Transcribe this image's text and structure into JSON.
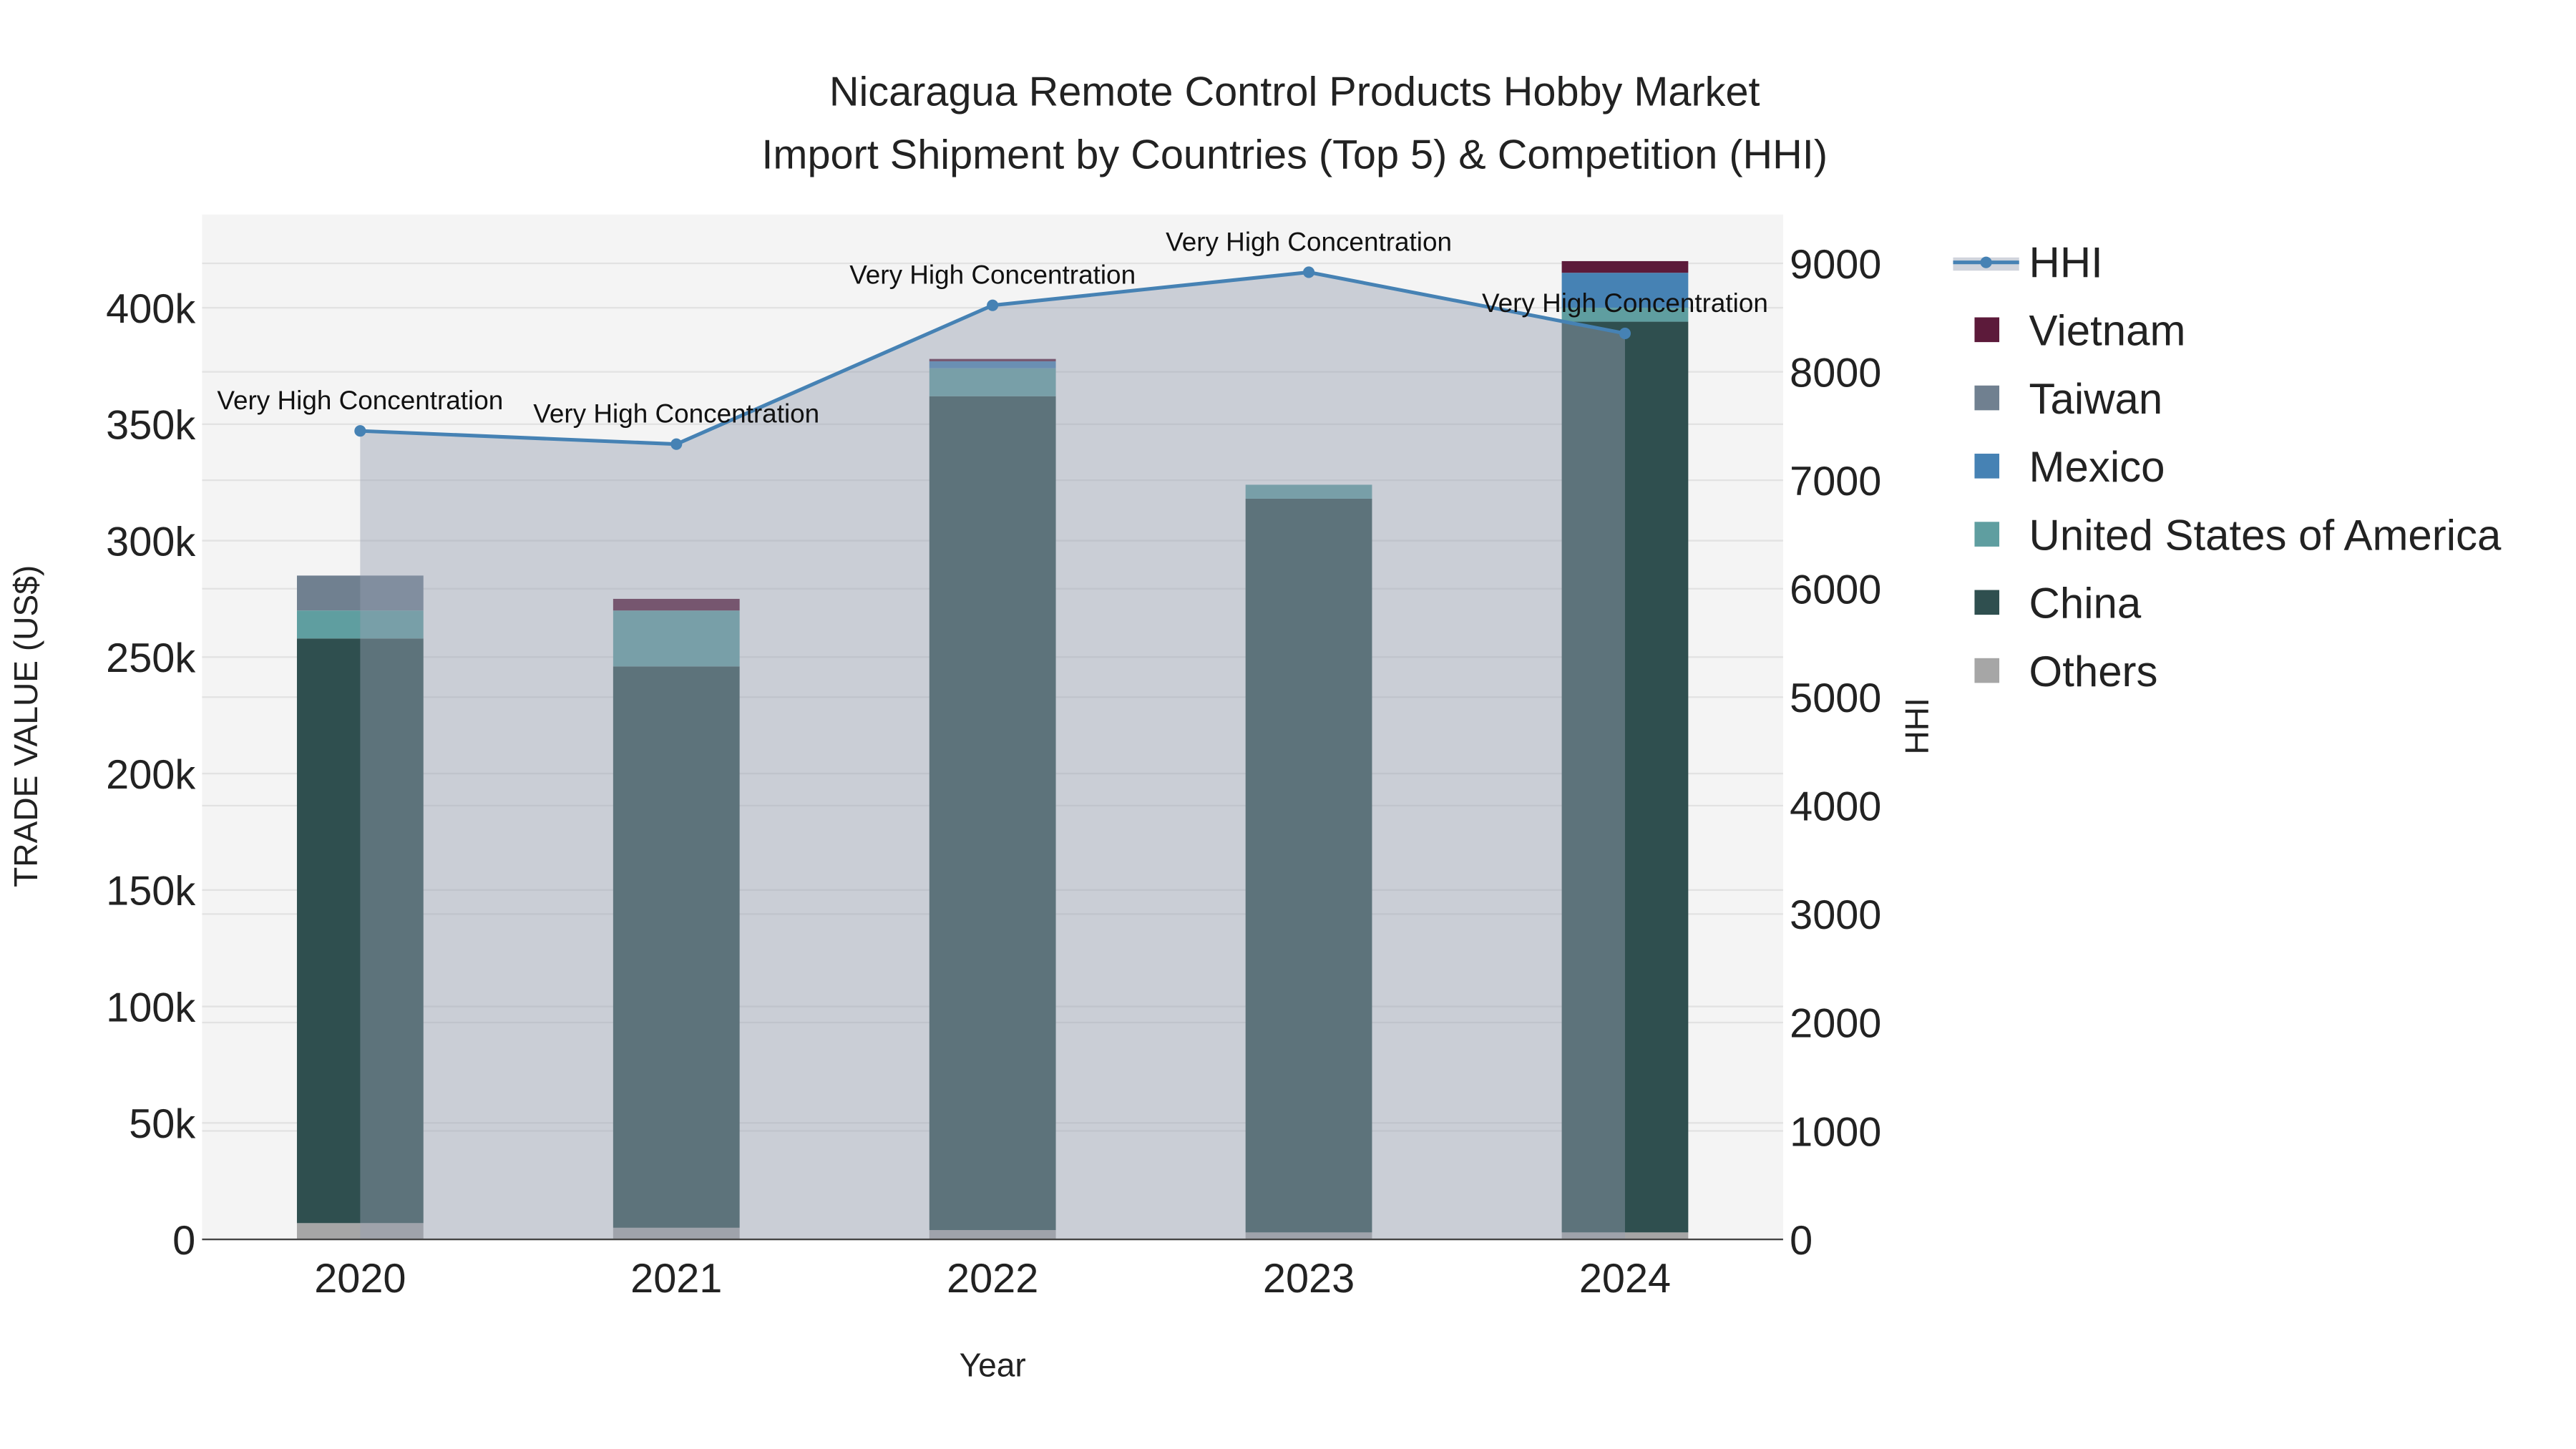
{
  "chart_data": {
    "type": "bar",
    "title": "Nicaragua Remote Control Products Hobby Market",
    "subtitle": "Import Shipment by Countries (Top 5) & Competition (HHI)",
    "xlabel": "Year",
    "ylabel": "TRADE VALUE (US$)",
    "y2label": "HHI",
    "categories": [
      "2020",
      "2021",
      "2022",
      "2023",
      "2024"
    ],
    "ylim": [
      0,
      440000
    ],
    "y2lim": [
      0,
      9450
    ],
    "yticks": [
      0,
      50000,
      100000,
      150000,
      200000,
      250000,
      300000,
      350000,
      400000
    ],
    "ytick_labels": [
      "0",
      "50k",
      "100k",
      "150k",
      "200k",
      "250k",
      "300k",
      "350k",
      "400k"
    ],
    "y2ticks": [
      0,
      1000,
      2000,
      3000,
      4000,
      5000,
      6000,
      7000,
      8000,
      9000
    ],
    "y2tick_labels": [
      "0",
      "1000",
      "2000",
      "3000",
      "4000",
      "5000",
      "6000",
      "7000",
      "8000",
      "9000"
    ],
    "series": [
      {
        "name": "Others",
        "color": "#a6a6a6",
        "values": [
          7000,
          5000,
          4000,
          3000,
          3000
        ]
      },
      {
        "name": "China",
        "color": "#2f4f4f",
        "values": [
          251000,
          241000,
          358000,
          315000,
          391000
        ]
      },
      {
        "name": "United States of America",
        "color": "#5f9ea0",
        "values": [
          12000,
          24000,
          12000,
          6000,
          6000
        ]
      },
      {
        "name": "Mexico",
        "color": "#4682b4",
        "values": [
          0,
          0,
          3000,
          0,
          15000
        ]
      },
      {
        "name": "Taiwan",
        "color": "#708090",
        "values": [
          15000,
          0,
          0,
          0,
          0
        ]
      },
      {
        "name": "Vietnam",
        "color": "#5c1a3a",
        "values": [
          0,
          5000,
          1000,
          0,
          5000
        ]
      }
    ],
    "hhi": {
      "name": "HHI",
      "color": "#4682b4",
      "values": [
        7455,
        7333,
        8613,
        8918,
        8354
      ],
      "annotations": [
        "Very High Concentration",
        "Very High Concentration",
        "Very High Concentration",
        "Very High Concentration",
        "Very High Concentration"
      ]
    },
    "legend": {
      "placement": "right",
      "entries": [
        "HHI",
        "Vietnam",
        "Taiwan",
        "Mexico",
        "United States of America",
        "China",
        "Others"
      ]
    },
    "grid": true
  }
}
